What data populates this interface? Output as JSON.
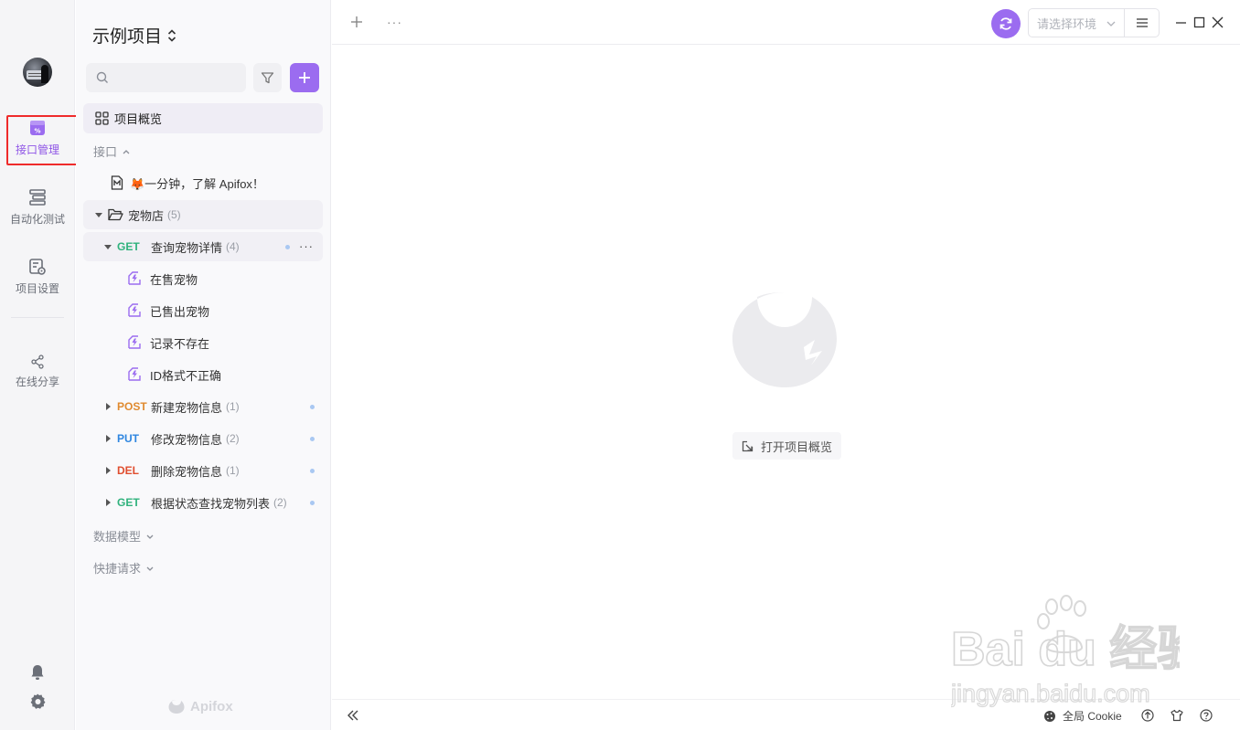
{
  "rail": {
    "items": [
      {
        "label": "接口管理",
        "active": true
      },
      {
        "label": "自动化测试"
      },
      {
        "label": "项目设置"
      },
      {
        "label": "在线分享"
      }
    ]
  },
  "sidebar": {
    "project_title": "示例项目",
    "search_placeholder": "",
    "overview_label": "项目概览",
    "section_api": "接口",
    "doc_item": "🦊一分钟，了解 Apifox！",
    "folder": {
      "name": "宠物店",
      "count": "(5)"
    },
    "endpoints": [
      {
        "method": "GET",
        "name": "查询宠物详情",
        "count": "(4)",
        "expanded": true,
        "cases": [
          "在售宠物",
          "已售出宠物",
          "记录不存在",
          "ID格式不正确"
        ]
      },
      {
        "method": "POST",
        "name": "新建宠物信息",
        "count": "(1)"
      },
      {
        "method": "PUT",
        "name": "修改宠物信息",
        "count": "(2)"
      },
      {
        "method": "DEL",
        "name": "删除宠物信息",
        "count": "(1)"
      },
      {
        "method": "GET",
        "name": "根据状态查找宠物列表",
        "count": "(2)"
      }
    ],
    "section_models": "数据模型",
    "section_quick": "快捷请求",
    "brand": "Apifox"
  },
  "topbar": {
    "env_placeholder": "请选择环境"
  },
  "main": {
    "open_overview": "打开项目概览"
  },
  "statusbar": {
    "cookie_label": "全局 Cookie"
  },
  "watermark": {
    "text_main": "Bai du 经验",
    "text_url": "jingyan.baidu.com"
  },
  "colors": {
    "accent": "#9b6cf0",
    "get": "#30b27d",
    "post": "#e08a2f",
    "put": "#2f86e0",
    "del": "#e04e2f",
    "highlight": "#ef2b2b"
  }
}
